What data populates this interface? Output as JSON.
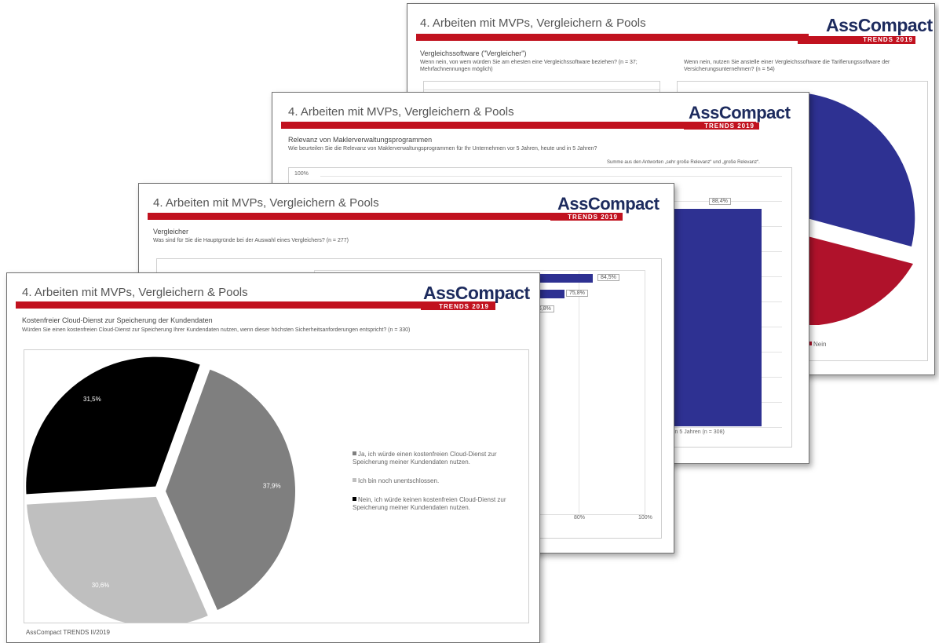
{
  "brand": {
    "logo_part1": "Ass",
    "logo_part2": "Compact",
    "trends": "TRENDS 2019",
    "colors": {
      "red": "#c1121f",
      "navy": "#1d2b5e",
      "bar_blue": "#2e3192"
    }
  },
  "slide4": {
    "title": "4. Arbeiten mit MVPs, Vergleichern & Pools",
    "subtitle": "Vergleichssoftware (\"Vergleicher\")",
    "q_left": "Wenn nein, von wem würden Sie am ehesten eine Vergleichssoftware beziehen? (n = 37; Mehrfachnennungen möglich)",
    "q_right": "Wenn nein, nutzen Sie anstelle einer Vergleichssoftware die Tarifierungssoftware der Versicherungsunternehmen? (n = 54)",
    "legend_nein": "Nein"
  },
  "slide3": {
    "title": "4. Arbeiten mit MVPs, Vergleichern & Pools",
    "subtitle": "Relevanz von Maklerverwaltungsprogrammen",
    "question": "Wie beurteilen Sie die Relevanz von Maklerverwaltungsprogrammen für Ihr Unternehmen vor 5 Jahren, heute und in 5 Jahren?",
    "note": "Summe aus den Antworten „sehr große Relevanz“ und „große Relevanz“.",
    "ytick_top": "100%",
    "bar_label": "88,4%",
    "xcat": "in 5 Jahren (n = 308)"
  },
  "slide2": {
    "title": "4. Arbeiten mit MVPs, Vergleichern & Pools",
    "subtitle": "Vergleicher",
    "question": "Was sind für Sie die Hauptgründe bei der Auswahl eines Vergleichers? (n = 277)",
    "xtick_80": "80%",
    "xtick_100": "100%"
  },
  "slide1": {
    "title": "4. Arbeiten mit MVPs, Vergleichern & Pools",
    "subtitle": "Kostenfreier Cloud-Dienst zur Speicherung der Kundendaten",
    "question": "Würden Sie einen kostenfreien Cloud-Dienst zur Speicherung Ihrer Kundendaten nutzen, wenn dieser höchsten Sicherheitsanforderungen entspricht? (n = 330)",
    "footer": "AssCompact TRENDS II/2019"
  },
  "chart_data": [
    {
      "type": "pie",
      "slices": [
        {
          "label": "Ja, ich würde einen kostenfreien Cloud-Dienst zur Speicherung meiner Kundendaten nutzen.",
          "value": 37.9,
          "value_label": "37,9%",
          "color": "#7f7f7f"
        },
        {
          "label": "Ich bin noch unentschlossen.",
          "value": 30.6,
          "value_label": "30,6%",
          "color": "#bfbfbf"
        },
        {
          "label": "Nein, ich würde keinen kostenfreien Cloud-Dienst zur Speicherung meiner Kundendaten nutzen.",
          "value": 31.5,
          "value_label": "31,5%",
          "color": "#000000"
        }
      ],
      "legend_position": "right"
    },
    {
      "type": "bar",
      "orientation": "horizontal",
      "values": [
        84.5,
        75.8,
        66.8
      ],
      "value_labels": [
        "84,5%",
        "75,8%",
        "66,8%"
      ],
      "xlim": [
        0,
        100
      ],
      "xticks": [
        "80%",
        "100%"
      ]
    },
    {
      "type": "bar",
      "categories": [
        "in 5 Jahren (n = 308)"
      ],
      "values": [
        88.4
      ],
      "value_labels": [
        "88,4%"
      ],
      "ylim": [
        0,
        100
      ]
    },
    {
      "type": "pie",
      "slices": [
        {
          "label": "Nein",
          "color": "#b0122b"
        }
      ]
    }
  ]
}
